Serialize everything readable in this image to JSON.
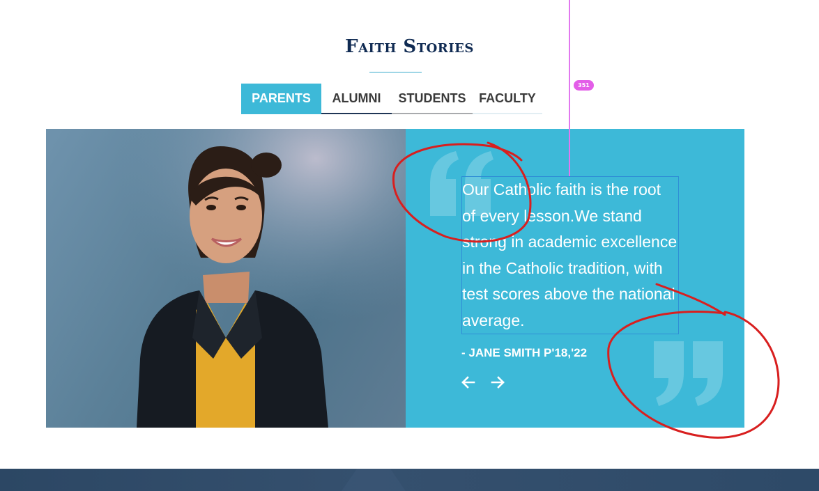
{
  "section": {
    "title": "Faith Stories"
  },
  "tabs": [
    {
      "label": "PARENTS",
      "active": true
    },
    {
      "label": "ALUMNI",
      "active": false
    },
    {
      "label": "STUDENTS",
      "active": false
    },
    {
      "label": "FACULTY",
      "active": false
    }
  ],
  "testimonial": {
    "quote": "Our Catholic faith is the root of every lesson.We stand strong in academic excellence in the Catholic tradition, with test scores above the national average.",
    "author": "- JANE SMITH P'18,'22",
    "photo_subject": "smiling woman in black blazer and yellow top"
  },
  "navigation": {
    "prev_icon": "arrow-left-icon",
    "next_icon": "arrow-right-icon"
  },
  "guide": {
    "badge": "351"
  },
  "colors": {
    "accent": "#3db9d8",
    "title": "#0f2a52",
    "guide": "#e35ee8",
    "annotation": "#d81f1f",
    "footer": "#2f4a68"
  }
}
